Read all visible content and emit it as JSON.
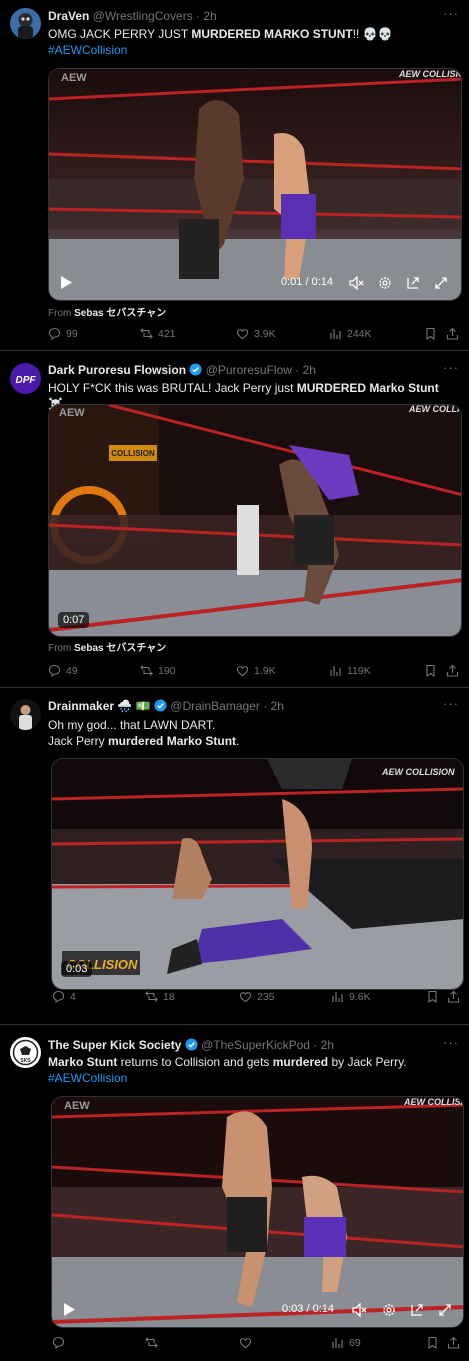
{
  "tweets": [
    {
      "name": "DraVen",
      "handle": "@WrestlingCovers",
      "time": "· 2h",
      "text_a": "OMG JACK PERRY JUST ",
      "text_b": "MURDERED MARKO STUNT",
      "text_c": "!! 💀💀",
      "hashtag": "#AEWCollision",
      "from_prefix": "From",
      "from_name": "Sebas セバスチャン",
      "video_time": "0:01 / 0:14",
      "replies": "99",
      "reposts": "421",
      "likes": "3.9K",
      "views": "244K"
    },
    {
      "name": "Dark Puroresu Flowsion",
      "handle": "@PuroresuFlow",
      "time": "· 2h",
      "text_a": "HOLY F*CK this was BRUTAL! Jack Perry just ",
      "text_b": "MURDERED",
      "text_c": " ",
      "text_d": "Marko Stunt",
      "text_e": " ☠️",
      "from_prefix": "From",
      "from_name": "Sebas セバスチャン",
      "video_time": "0:07",
      "replies": "49",
      "reposts": "190",
      "likes": "1.9K",
      "views": "119K"
    },
    {
      "name": "Drainmaker 🌧️ 💵",
      "handle": "@DrainBamager",
      "time": "· 2h",
      "line1": "Oh my god... that LAWN DART.",
      "line2_a": "Jack Perry ",
      "line2_b": "murdered Marko Stunt",
      "line2_c": ".",
      "video_time": "0:03",
      "replies": "4",
      "reposts": "18",
      "likes": "235",
      "views": "9.6K"
    },
    {
      "name": "The Super Kick Society",
      "handle": "@TheSuperKickPod",
      "time": "· 2h",
      "text_a": "Marko Stunt",
      "text_b": " returns to Collision and gets ",
      "text_c": "murdered",
      "text_d": " by Jack Perry.",
      "hashtag": "#AEWCollision",
      "video_time": "0:03 / 0:14",
      "views": "69"
    }
  ],
  "colors": {
    "accent": "#1d9bf0",
    "muted": "#71767b",
    "text": "#e7e9ea",
    "border": "#2f3336",
    "verified": "#1d9bf0"
  },
  "watermarks": {
    "collision": "AEW COLLISION",
    "aew": "AEW",
    "collision_logo": "COLLISION"
  },
  "icons": [
    "reply-icon",
    "repost-icon",
    "like-icon",
    "views-icon",
    "bookmark-icon",
    "share-icon",
    "play-icon",
    "mute-icon",
    "settings-icon",
    "pip-icon",
    "fullscreen-icon",
    "more-icon",
    "verified-icon"
  ]
}
